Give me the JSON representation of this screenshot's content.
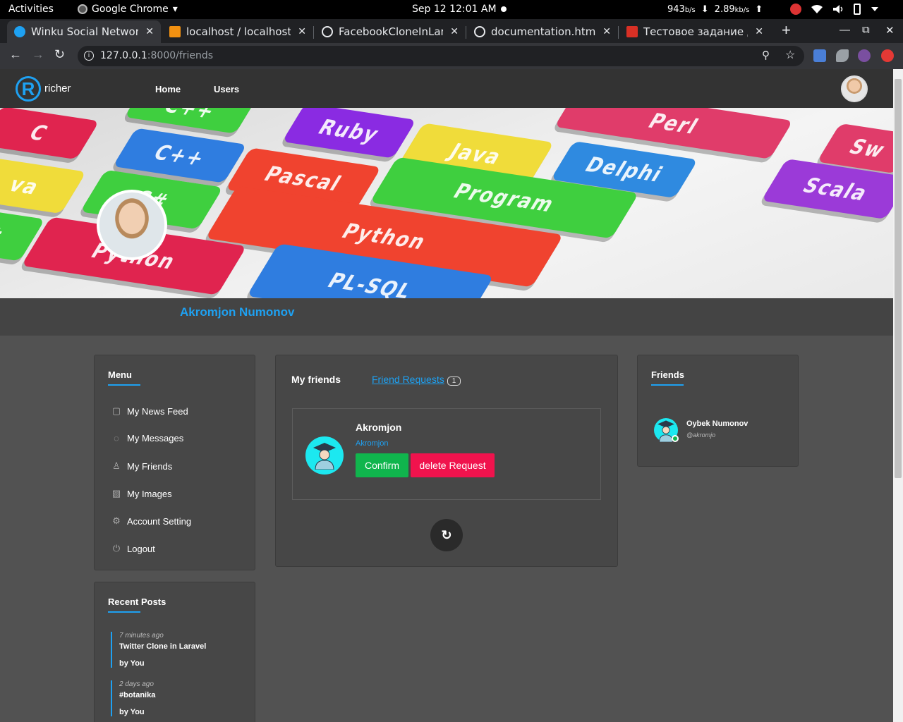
{
  "system_bar": {
    "activities": "Activities",
    "app_name": "Google Chrome",
    "app_menu_caret": "▾",
    "clock": "Sep 12  12:01 AM",
    "net_down_value": "943",
    "net_down_unit": "b/s",
    "net_up_value": "2.89",
    "net_up_unit": "kb/s",
    "down_arrow": "⬇",
    "up_arrow": "⬆"
  },
  "browser": {
    "tabs": [
      {
        "title": "Winku Social Network",
        "favicon_color": "#1ea1f2",
        "active": true
      },
      {
        "title": "localhost / localhost / l",
        "favicon_color": "#f29111",
        "active": false
      },
      {
        "title": "FacebookCloneInLarav",
        "favicon_color": "#e8eaed",
        "active": false
      },
      {
        "title": "documentation.html",
        "favicon_color": "#e8eaed",
        "active": false
      },
      {
        "title": "Тестовое задание для",
        "favicon_color": "#d93025",
        "active": false
      }
    ],
    "tab_close": "✕",
    "new_tab": "+",
    "window_controls": {
      "minimize": "—",
      "maximize": "⧉",
      "close": "✕"
    },
    "nav": {
      "back": "←",
      "forward": "→",
      "reload": "↻"
    },
    "url_host": "127.0.0.1",
    "url_path": ":8000/friends",
    "info_glyph": "i",
    "zoom_glyph": "⚲",
    "star_glyph": "☆"
  },
  "site": {
    "logo_letter": "R",
    "logo_text": "richer",
    "nav": {
      "home": "Home",
      "users": "Users"
    }
  },
  "cover_keys": [
    "C",
    "C++",
    "Ruby",
    "Java",
    "Perl",
    "Sw",
    "C++",
    "Pascal",
    "Delphi",
    "Scala",
    "va",
    "C#",
    "Program",
    "Python",
    "Python",
    "t",
    "PL-SQL"
  ],
  "profile": {
    "name": "Akromjon Numonov"
  },
  "menu": {
    "title": "Menu",
    "items": [
      {
        "label": "My News Feed",
        "icon": "▢"
      },
      {
        "label": "My Messages",
        "icon": "◌"
      },
      {
        "label": "My Friends",
        "icon": "♙"
      },
      {
        "label": "My Images",
        "icon": "▨"
      },
      {
        "label": "Account Setting",
        "icon": "⚙"
      },
      {
        "label": "Logout",
        "icon": "⏻"
      }
    ]
  },
  "recent_posts": {
    "title": "Recent Posts",
    "items": [
      {
        "time": "7 minutes ago",
        "title": "Twitter Clone in Laravel",
        "by": "by You"
      },
      {
        "time": "2 days ago",
        "title": "#botanika",
        "by": "by You"
      }
    ]
  },
  "friends_center": {
    "tab_my_friends": "My friends",
    "tab_requests": "Friend Requests",
    "requests_count": "1",
    "request": {
      "name": "Akromjon",
      "username": "Akromjon",
      "confirm_label": "Confirm",
      "delete_label": "delete Request"
    },
    "reload_glyph": "↻"
  },
  "friends_sidebar": {
    "title": "Friends",
    "items": [
      {
        "name": "Oybek Numonov",
        "handle": "@akromjo"
      }
    ]
  },
  "colors": {
    "accent": "#1ea1f2",
    "confirm": "#10b54d",
    "delete": "#f0134d",
    "avatar_bg": "#1ce8f0"
  }
}
